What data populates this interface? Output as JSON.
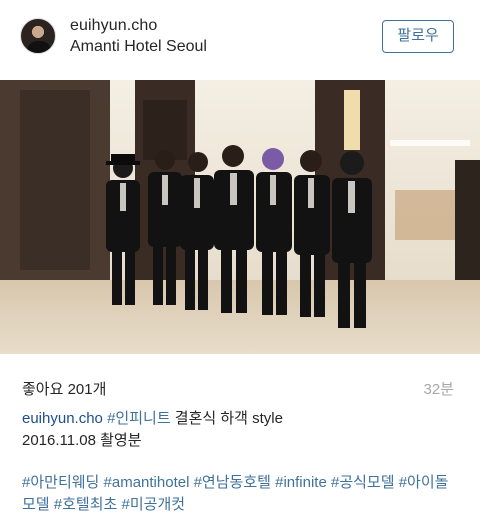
{
  "header": {
    "username": "euihyun.cho",
    "location": "Amanti Hotel Seoul",
    "follow_label": "팔로우"
  },
  "post": {
    "likes_label": "좋아요 201개",
    "time_ago": "32분",
    "caption": {
      "user": "euihyun.cho",
      "tag": "#인피니트",
      "text": " 결혼식 하객 style",
      "line2": "2016.11.08 촬영분"
    },
    "hashtags": [
      "#아만티웨딩",
      "#amantihotel",
      "#연남동호텔",
      "#infinite",
      "#공식모델",
      "#아이돌모델",
      "#호텔최초",
      "#미공개컷"
    ]
  }
}
